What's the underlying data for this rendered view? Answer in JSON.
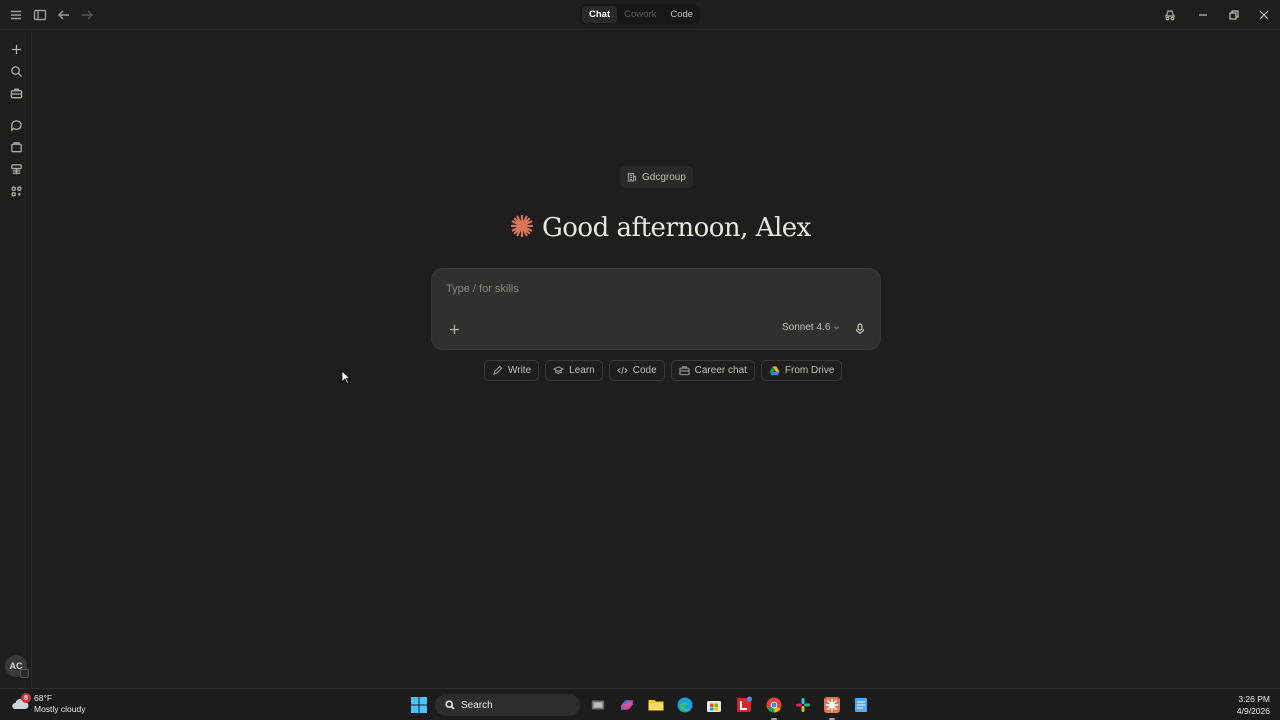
{
  "titlebar": {
    "modes": [
      {
        "label": "Chat",
        "state": "active"
      },
      {
        "label": "Cowork",
        "state": "disabled"
      },
      {
        "label": "Code",
        "state": "normal"
      }
    ]
  },
  "main": {
    "org_label": "Gdcgroup",
    "greeting": "Good afternoon, Alex",
    "composer_placeholder": "Type / for skills",
    "model_label": "Sonnet 4.6",
    "quick_actions": [
      "Write",
      "Learn",
      "Code",
      "Career chat",
      "From Drive"
    ]
  },
  "user": {
    "initials": "AC"
  },
  "taskbar": {
    "weather_badge": "8",
    "temperature": "68°F",
    "condition": "Mostly cloudy",
    "search_label": "Search",
    "time": "3:26 PM",
    "date": "4/9/2026"
  },
  "colors": {
    "accent": "#d97757",
    "background": "#1f1e1d",
    "composer": "#30302e"
  }
}
